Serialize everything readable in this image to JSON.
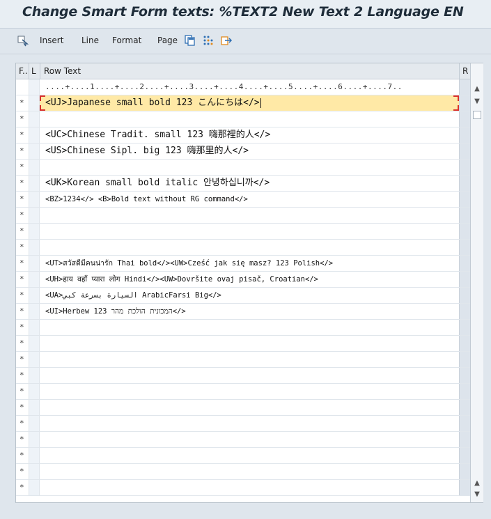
{
  "window": {
    "title": "Change Smart Form texts: %TEXT2 New Text 2 Language EN"
  },
  "toolbar": {
    "insert": "Insert",
    "line": "Line",
    "format": "Format",
    "page": "Page",
    "icons": [
      "select-all-icon",
      "copy-page-icon",
      "grid-dots-icon",
      "export-icon"
    ]
  },
  "table": {
    "headers": {
      "col1": "F..",
      "col2": "L",
      "col3": "Row Text",
      "col4": "R"
    },
    "ruler": "....+....1....+....2....+....3....+....4....+....5....+....6....+....7..",
    "rows": [
      {
        "f": "*",
        "text": "<UJ>Japanese small bold 123 こんにちは</>",
        "selected": true,
        "small": false
      },
      {
        "f": "*",
        "text": "",
        "selected": false,
        "small": false
      },
      {
        "f": "*",
        "text": "<UC>Chinese Tradit. small 123 嗨那裡的人</>",
        "selected": false,
        "small": false
      },
      {
        "f": "*",
        "text": "<US>Chinese Sipl. big 123 嗨那里的人</>",
        "selected": false,
        "small": false
      },
      {
        "f": "*",
        "text": "",
        "selected": false,
        "small": false
      },
      {
        "f": "*",
        "text": "<UK>Korean small bold italic 안녕하십니까</>",
        "selected": false,
        "small": false
      },
      {
        "f": "*",
        "text": "<BZ>1234</> <B>Bold text without RG command</>",
        "selected": false,
        "small": true
      },
      {
        "f": "*",
        "text": "",
        "selected": false,
        "small": false
      },
      {
        "f": "*",
        "text": "",
        "selected": false,
        "small": false
      },
      {
        "f": "*",
        "text": "",
        "selected": false,
        "small": false
      },
      {
        "f": "*",
        "text": "<UT>สวัสดีมีคนน่ารัก Thai bold</><UW>Cześć jak się masz? 123 Polish</>",
        "selected": false,
        "small": true
      },
      {
        "f": "*",
        "text": "<UH>हाय वहाँ प्यारा लोग Hindi</><UW>Dovršite ovaj pisač, Croatian</>",
        "selected": false,
        "small": true
      },
      {
        "f": "*",
        "text": "<UA>السيارة بسرعة كبي ArabicFarsi Big</>",
        "selected": false,
        "small": true
      },
      {
        "f": "*",
        "text": "<UI>Herbew 123 המכונית הולכת מהר</>",
        "selected": false,
        "small": true
      },
      {
        "f": "*",
        "text": "",
        "selected": false,
        "small": false
      },
      {
        "f": "*",
        "text": "",
        "selected": false,
        "small": false
      },
      {
        "f": "*",
        "text": "",
        "selected": false,
        "small": false
      },
      {
        "f": "*",
        "text": "",
        "selected": false,
        "small": false
      },
      {
        "f": "*",
        "text": "",
        "selected": false,
        "small": false
      },
      {
        "f": "*",
        "text": "",
        "selected": false,
        "small": false
      },
      {
        "f": "*",
        "text": "",
        "selected": false,
        "small": false
      },
      {
        "f": "*",
        "text": "",
        "selected": false,
        "small": false
      },
      {
        "f": "*",
        "text": "",
        "selected": false,
        "small": false
      },
      {
        "f": "*",
        "text": "",
        "selected": false,
        "small": false
      },
      {
        "f": "*",
        "text": "",
        "selected": false,
        "small": false
      }
    ]
  },
  "colors": {
    "accent_selection": "#ffe9a6",
    "marker_red": "#d9302c"
  }
}
